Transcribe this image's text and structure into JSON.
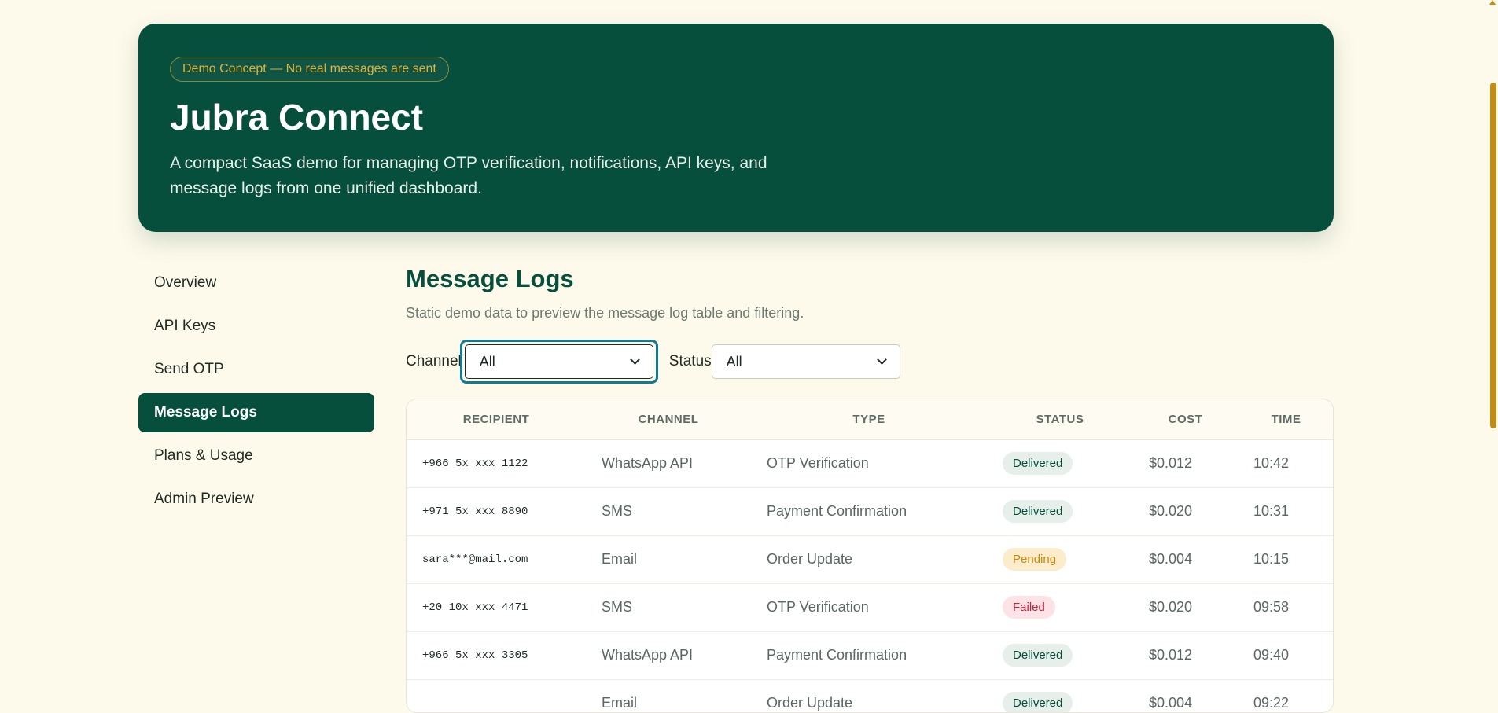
{
  "hero": {
    "badge": "Demo Concept — No real messages are sent",
    "title": "Jubra Connect",
    "description": "A compact SaaS demo for managing OTP verification, notifications, API keys, and message logs from one unified dashboard."
  },
  "sidebar": {
    "items": [
      {
        "label": "Overview",
        "active": false
      },
      {
        "label": "API Keys",
        "active": false
      },
      {
        "label": "Send OTP",
        "active": false
      },
      {
        "label": "Message Logs",
        "active": true
      },
      {
        "label": "Plans & Usage",
        "active": false
      },
      {
        "label": "Admin Preview",
        "active": false
      }
    ]
  },
  "main": {
    "title": "Message Logs",
    "subtitle": "Static demo data to preview the message log table and filtering.",
    "filters": {
      "channel": {
        "label": "Channel",
        "value": "All"
      },
      "status": {
        "label": "Status",
        "value": "All"
      }
    },
    "table": {
      "headers": [
        "RECIPIENT",
        "CHANNEL",
        "TYPE",
        "STATUS",
        "COST",
        "TIME"
      ],
      "rows": [
        {
          "recipient": "+966 5x xxx 1122",
          "channel": "WhatsApp API",
          "type": "OTP Verification",
          "status": "Delivered",
          "cost": "$0.012",
          "time": "10:42"
        },
        {
          "recipient": "+971 5x xxx 8890",
          "channel": "SMS",
          "type": "Payment Confirmation",
          "status": "Delivered",
          "cost": "$0.020",
          "time": "10:31"
        },
        {
          "recipient": "sara***@mail.com",
          "channel": "Email",
          "type": "Order Update",
          "status": "Pending",
          "cost": "$0.004",
          "time": "10:15"
        },
        {
          "recipient": "+20 10x xxx 4471",
          "channel": "SMS",
          "type": "OTP Verification",
          "status": "Failed",
          "cost": "$0.020",
          "time": "09:58"
        },
        {
          "recipient": "+966 5x xxx 3305",
          "channel": "WhatsApp API",
          "type": "Payment Confirmation",
          "status": "Delivered",
          "cost": "$0.012",
          "time": "09:40"
        },
        {
          "recipient": "",
          "channel": "Email",
          "type": "Order Update",
          "status": "Delivered",
          "cost": "$0.004",
          "time": "09:22"
        }
      ]
    }
  },
  "colors": {
    "brand": "#074f3d",
    "background": "#fefaeb",
    "accent": "#e0b137",
    "focus": "#0e7c92"
  }
}
